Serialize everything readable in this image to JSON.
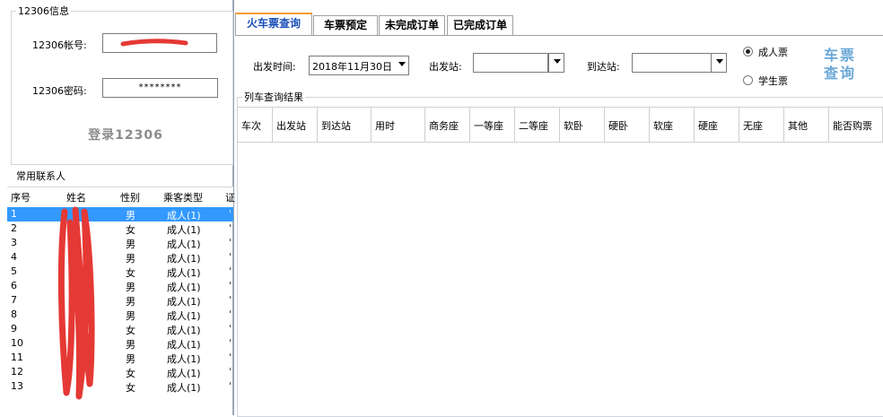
{
  "account_group": {
    "title": "12306信息",
    "username_label": "12306帐号:",
    "password_label": "12306密码:",
    "password_value": "********",
    "login_button": "登录12306"
  },
  "contacts": {
    "title": "常用联系人",
    "columns": [
      "序号",
      "姓名",
      "性别",
      "乘客类型",
      "证"
    ],
    "rows": [
      {
        "no": "1",
        "gender": "男",
        "type": "成人(1)"
      },
      {
        "no": "2",
        "gender": "女",
        "type": "成人(1)"
      },
      {
        "no": "3",
        "gender": "男",
        "type": "成人(1)"
      },
      {
        "no": "4",
        "gender": "男",
        "type": "成人(1)"
      },
      {
        "no": "5",
        "gender": "女",
        "type": "成人(1)"
      },
      {
        "no": "6",
        "gender": "男",
        "type": "成人(1)"
      },
      {
        "no": "7",
        "gender": "男",
        "type": "成人(1)"
      },
      {
        "no": "8",
        "gender": "男",
        "type": "成人(1)"
      },
      {
        "no": "9",
        "gender": "女",
        "type": "成人(1)"
      },
      {
        "no": "10",
        "gender": "男",
        "type": "成人(1)"
      },
      {
        "no": "11",
        "gender": "男",
        "type": "成人(1)"
      },
      {
        "no": "12",
        "gender": "女",
        "type": "成人(1)"
      },
      {
        "no": "13",
        "gender": "女",
        "type": "成人(1)"
      }
    ]
  },
  "tabs": [
    "火车票查询",
    "车票预定",
    "未完成订单",
    "已完成订单"
  ],
  "search": {
    "depart_time_label": "出发时间:",
    "depart_time_value": "2018年11月30日",
    "from_label": "出发站:",
    "to_label": "到达站:",
    "ticket_adult": "成人票",
    "ticket_student": "学生票",
    "query_button_line1": "车票",
    "query_button_line2": "查询"
  },
  "results": {
    "title": "列车查询结果",
    "columns": [
      "车次",
      "出发站",
      "到达站",
      "用时",
      "商务座",
      "一等座",
      "二等座",
      "软卧",
      "硬卧",
      "软座",
      "硬座",
      "无座",
      "其他",
      "能否购票"
    ]
  },
  "colors": {
    "selection": "#3399ff",
    "active_tab_text": "#1a4fb8",
    "active_tab_accent": "#f0a030",
    "query_button": "#6aa8d8",
    "redaction": "#e53935"
  }
}
